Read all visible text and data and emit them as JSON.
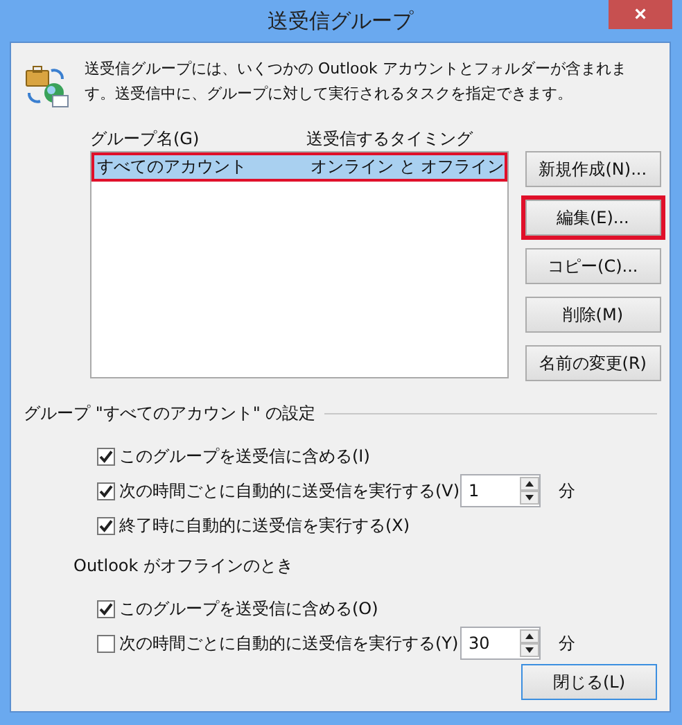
{
  "window": {
    "title": "送受信グループ",
    "close": "×"
  },
  "description": "送受信グループには、いくつかの Outlook アカウントとフォルダーが含まれます。送受信中に、グループに対して実行されるタスクを指定できます。",
  "table": {
    "columns": [
      "グループ名(G)",
      "送受信するタイミング"
    ],
    "rows": [
      {
        "cells": [
          "すべてのアカウント",
          "オンライン と オフライン"
        ],
        "selected": true,
        "highlighted": true
      }
    ]
  },
  "buttons": [
    {
      "label": "新規作成(N)...",
      "highlighted": false
    },
    {
      "label": "編集(E)...",
      "highlighted": true
    },
    {
      "label": "コピー(C)...",
      "highlighted": false
    },
    {
      "label": "削除(M)",
      "highlighted": false
    },
    {
      "label": "名前の変更(R)",
      "highlighted": false
    }
  ],
  "sections": [
    {
      "kind": "groupbox",
      "heading": "グループ \"すべてのアカウント\" の設定",
      "options": [
        {
          "kind": "check",
          "label": "このグループを送受信に含める(I)",
          "checked": true
        },
        {
          "kind": "spin",
          "label": "次の時間ごとに自動的に送受信を実行する(V)",
          "checked": true,
          "value": "1",
          "unit": "分"
        },
        {
          "kind": "check",
          "label": "終了時に自動的に送受信を実行する(X)",
          "checked": true
        }
      ]
    },
    {
      "kind": "label",
      "heading": "Outlook がオフラインのとき",
      "options": [
        {
          "kind": "check",
          "label": "このグループを送受信に含める(O)",
          "checked": true
        },
        {
          "kind": "spin",
          "label": "次の時間ごとに自動的に送受信を実行する(Y)",
          "checked": false,
          "value": "30",
          "unit": "分"
        }
      ]
    }
  ],
  "footer_button": {
    "label": "閉じる(L)",
    "focused": true
  }
}
